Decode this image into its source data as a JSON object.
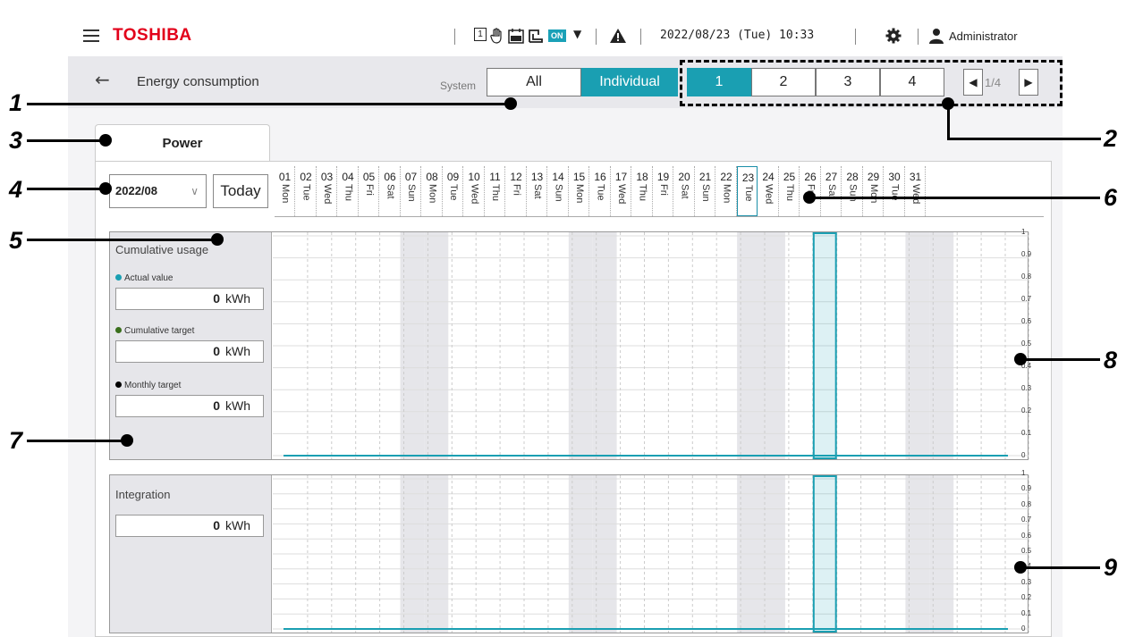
{
  "topbar": {
    "brand": "TOSHIBA",
    "status_box_label": "1",
    "on_badge": "ON",
    "datetime": "2022/08/23 (Tue) 10:33",
    "user": "Administrator"
  },
  "header": {
    "title": "Energy consumption",
    "system_label": "System",
    "system_options": [
      "All",
      "Individual"
    ],
    "system_selected": "Individual",
    "units": [
      "1",
      "2",
      "3",
      "4"
    ],
    "unit_selected": "1",
    "page_indicator": "1/4"
  },
  "tab": {
    "label": "Power"
  },
  "date_controls": {
    "month": "2022/08",
    "today_label": "Today"
  },
  "days": [
    {
      "n": "01",
      "w": "Mon"
    },
    {
      "n": "02",
      "w": "Tue"
    },
    {
      "n": "03",
      "w": "Wed"
    },
    {
      "n": "04",
      "w": "Thu"
    },
    {
      "n": "05",
      "w": "Fri"
    },
    {
      "n": "06",
      "w": "Sat"
    },
    {
      "n": "07",
      "w": "Sun"
    },
    {
      "n": "08",
      "w": "Mon"
    },
    {
      "n": "09",
      "w": "Tue"
    },
    {
      "n": "10",
      "w": "Wed"
    },
    {
      "n": "11",
      "w": "Thu"
    },
    {
      "n": "12",
      "w": "Fri"
    },
    {
      "n": "13",
      "w": "Sat"
    },
    {
      "n": "14",
      "w": "Sun"
    },
    {
      "n": "15",
      "w": "Mon"
    },
    {
      "n": "16",
      "w": "Tue"
    },
    {
      "n": "17",
      "w": "Wed"
    },
    {
      "n": "18",
      "w": "Thu"
    },
    {
      "n": "19",
      "w": "Fri"
    },
    {
      "n": "20",
      "w": "Sat"
    },
    {
      "n": "21",
      "w": "Sun"
    },
    {
      "n": "22",
      "w": "Mon"
    },
    {
      "n": "23",
      "w": "Tue"
    },
    {
      "n": "24",
      "w": "Wed"
    },
    {
      "n": "25",
      "w": "Thu"
    },
    {
      "n": "26",
      "w": "Fri"
    },
    {
      "n": "27",
      "w": "Sat"
    },
    {
      "n": "28",
      "w": "Sun"
    },
    {
      "n": "29",
      "w": "Mon"
    },
    {
      "n": "30",
      "w": "Tue"
    },
    {
      "n": "31",
      "w": "Wed"
    }
  ],
  "selected_day": "23",
  "cumulative": {
    "title": "Cumulative usage",
    "actual_label": "Actual value",
    "actual_value": "0",
    "cum_target_label": "Cumulative target",
    "cum_target_value": "0",
    "monthly_label": "Monthly target",
    "monthly_value": "0",
    "unit": "kWh"
  },
  "integration": {
    "title": "Integration",
    "value": "0",
    "unit": "kWh"
  },
  "colors": {
    "accent": "#1a9fb2",
    "actual_dot": "#1a9fb2",
    "cum_target_dot": "#3a6f1c",
    "monthly_dot": "#000000",
    "brand": "#e2001a"
  },
  "chart_data": [
    {
      "type": "bar",
      "categories": [
        "01",
        "02",
        "03",
        "04",
        "05",
        "06",
        "07",
        "08",
        "09",
        "10",
        "11",
        "12",
        "13",
        "14",
        "15",
        "16",
        "17",
        "18",
        "19",
        "20",
        "21",
        "22",
        "23",
        "24",
        "25",
        "26",
        "27",
        "28",
        "29",
        "30",
        "31"
      ],
      "y_ticks": [
        "1",
        "0.9",
        "0.8",
        "0.7",
        "0.6",
        "0.5",
        "0.4",
        "0.3",
        "0.2",
        "0.1",
        "0"
      ],
      "ylim": [
        0,
        1
      ],
      "series": [
        {
          "values": [
            0,
            0,
            0,
            0,
            0,
            0,
            0,
            0,
            0,
            0,
            0,
            0,
            0,
            0,
            0,
            0,
            0,
            0,
            0,
            0,
            0,
            0,
            0,
            0,
            0,
            0,
            0,
            0,
            0,
            0,
            0
          ]
        }
      ]
    },
    {
      "type": "bar",
      "categories": [
        "01",
        "02",
        "03",
        "04",
        "05",
        "06",
        "07",
        "08",
        "09",
        "10",
        "11",
        "12",
        "13",
        "14",
        "15",
        "16",
        "17",
        "18",
        "19",
        "20",
        "21",
        "22",
        "23",
        "24",
        "25",
        "26",
        "27",
        "28",
        "29",
        "30",
        "31"
      ],
      "y_ticks": [
        "1",
        "0.9",
        "0.8",
        "0.7",
        "0.6",
        "0.5",
        "0.4",
        "0.3",
        "0.2",
        "0.1",
        "0"
      ],
      "ylim": [
        0,
        1
      ],
      "series": [
        {
          "values": [
            0,
            0,
            0,
            0,
            0,
            0,
            0,
            0,
            0,
            0,
            0,
            0,
            0,
            0,
            0,
            0,
            0,
            0,
            0,
            0,
            0,
            0,
            0,
            0,
            0,
            0,
            0,
            0,
            0,
            0,
            0
          ]
        }
      ]
    }
  ],
  "callouts": [
    "1",
    "2",
    "3",
    "4",
    "5",
    "6",
    "7",
    "8",
    "9"
  ]
}
